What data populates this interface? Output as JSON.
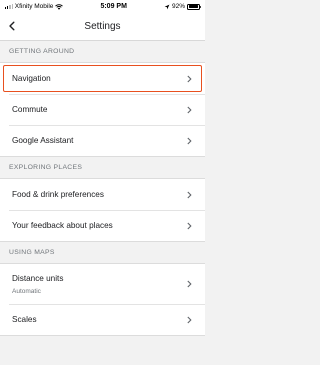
{
  "status_bar": {
    "carrier": "Xfinity Mobile",
    "time": "5:09 PM",
    "battery": "92%",
    "battery_level": 0.92
  },
  "app_bar": {
    "title": "Settings",
    "back_icon": "back-arrow-icon"
  },
  "sections": [
    {
      "header": "GETTING AROUND",
      "items": [
        {
          "label": "Navigation",
          "highlighted": true
        },
        {
          "label": "Commute"
        },
        {
          "label": "Google Assistant"
        }
      ]
    },
    {
      "header": "EXPLORING PLACES",
      "items": [
        {
          "label": "Food & drink preferences"
        },
        {
          "label": "Your feedback about places"
        }
      ]
    },
    {
      "header": "USING MAPS",
      "items": [
        {
          "label": "Distance units",
          "sublabel": "Automatic"
        },
        {
          "label": "Scales"
        }
      ]
    }
  ],
  "colors": {
    "highlight": "#e8501f",
    "background": "#f2f2f2"
  }
}
